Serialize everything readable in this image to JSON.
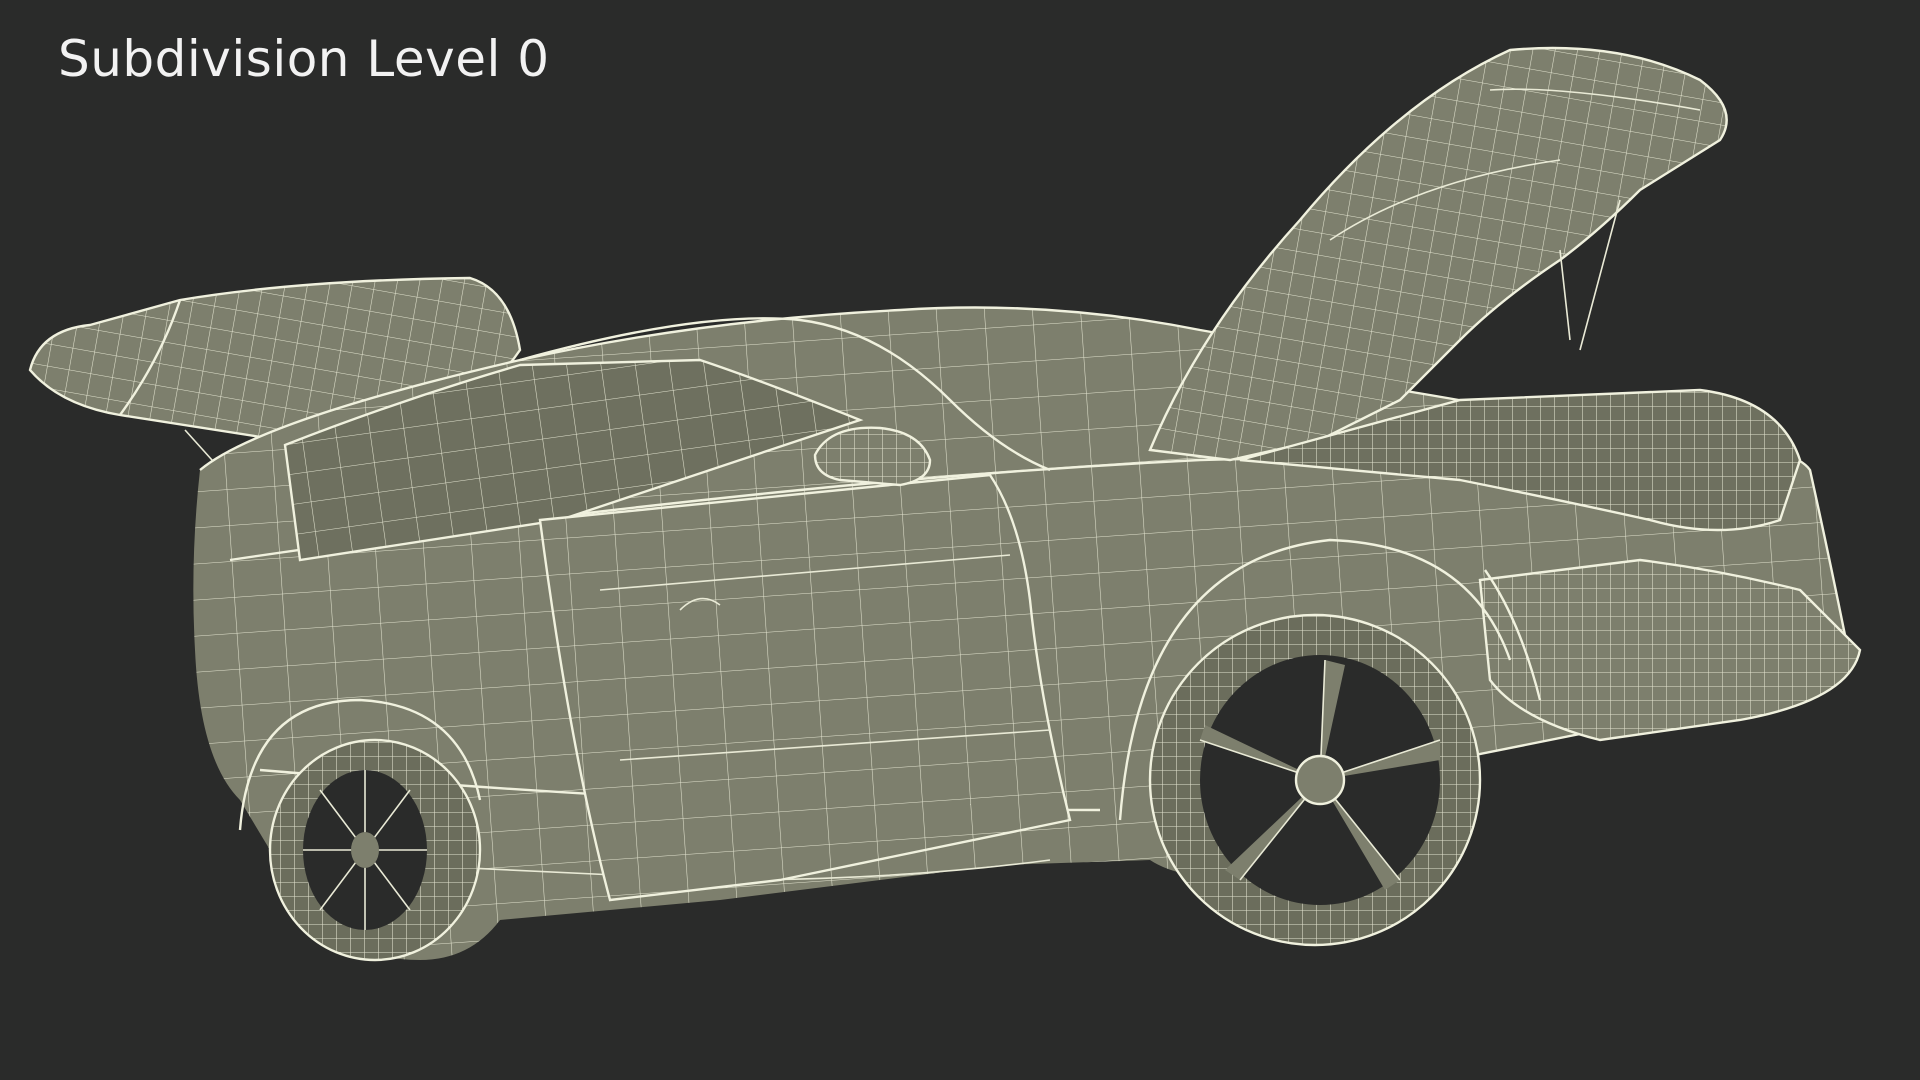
{
  "render": {
    "label": "Subdivision Level 0"
  },
  "colors": {
    "background": "#2a2b2a",
    "mesh_surface": "#7d7f6d",
    "wire": "#e9ead6",
    "label": "#f2f2f2"
  }
}
